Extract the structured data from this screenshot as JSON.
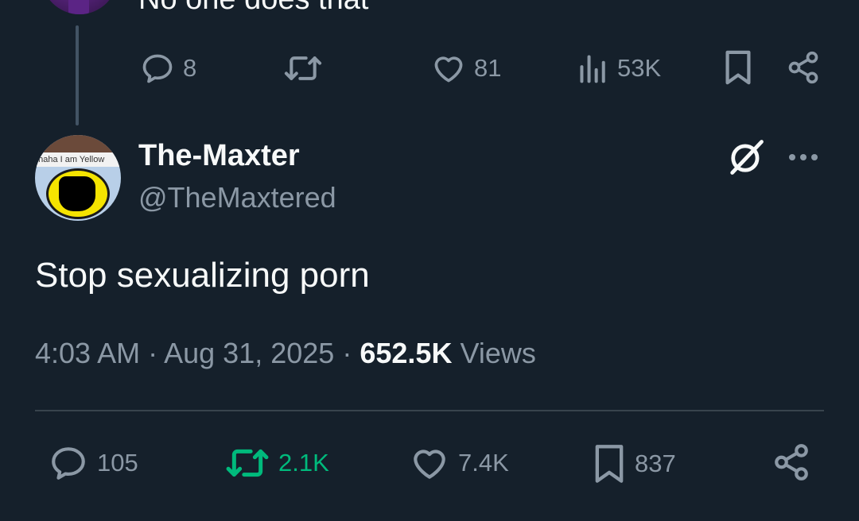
{
  "previous_tweet": {
    "text": "No one does that",
    "actions": {
      "replies": "8",
      "likes": "81",
      "views": "53K"
    }
  },
  "tweet": {
    "display_name": "The-Maxter",
    "handle": "@TheMaxtered",
    "avatar_caption": "ahaha I am Yellow",
    "text": "Stop sexualizing porn",
    "time": "4:03 AM",
    "separator": "·",
    "date": "Aug 31, 2025",
    "views_count": "652.5K",
    "views_label": "Views",
    "stats": {
      "replies": "105",
      "reposts": "2.1K",
      "likes": "7.4K",
      "bookmarks": "837"
    }
  },
  "icons": {
    "reply": "reply-icon",
    "repost": "repost-icon",
    "like": "heart-icon",
    "views": "views-icon",
    "bookmark": "bookmark-icon",
    "share": "share-icon",
    "grok": "grok-icon",
    "more": "more-icon"
  },
  "colors": {
    "background": "#15202b",
    "primary_text": "#f7f9f9",
    "secondary_text": "#8b98a5",
    "repost_active": "#00ba7c",
    "divider": "#38444d"
  }
}
